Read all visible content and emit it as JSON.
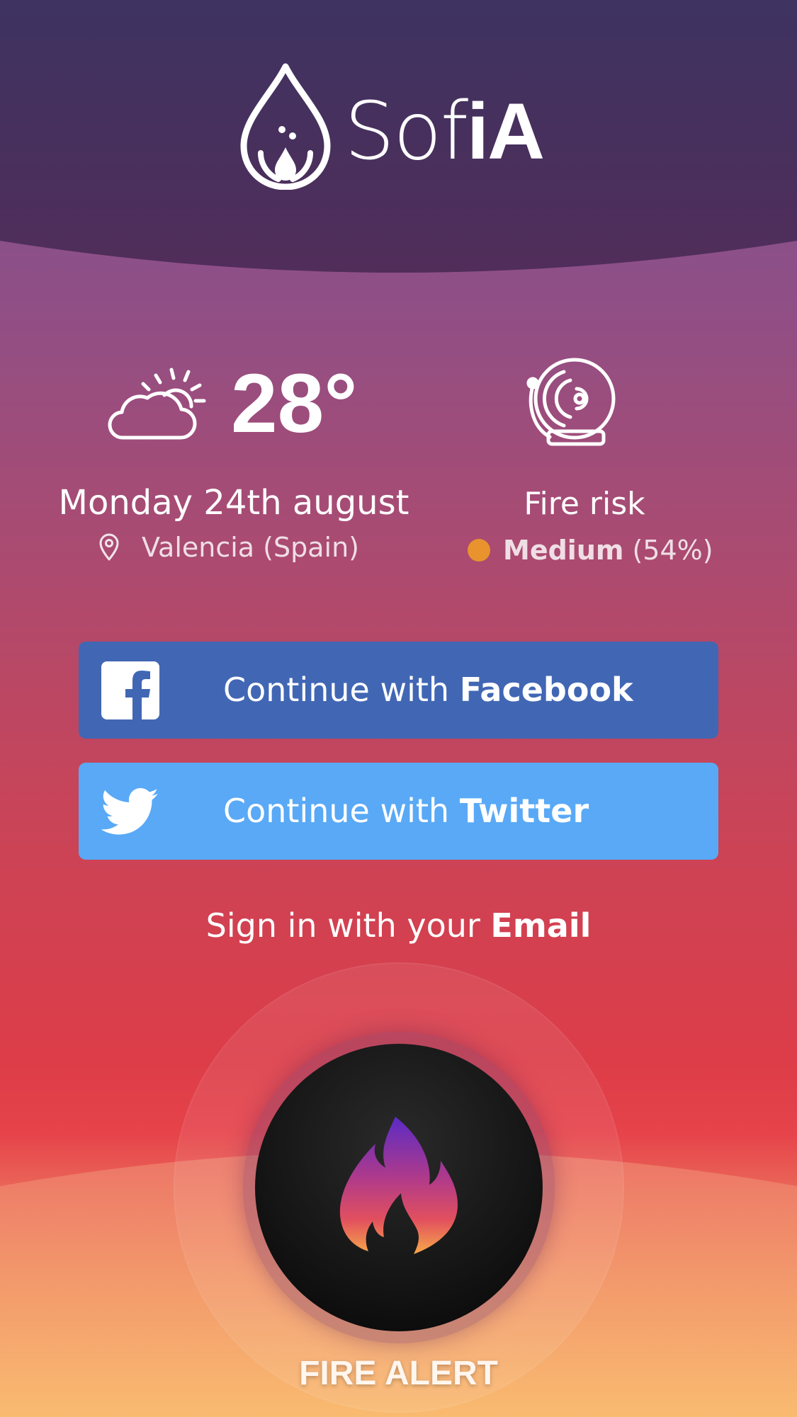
{
  "app": {
    "name_thin": "Sof",
    "name_bold": "iA"
  },
  "weather": {
    "icon": "partly-cloudy-icon",
    "temperature": "28°",
    "date": "Monday 24th august",
    "location_icon": "map-pin-icon",
    "location": "Valencia (Spain)"
  },
  "fire_risk": {
    "icon": "alarm-bell-icon",
    "label": "Fire risk",
    "level": "Medium",
    "percent": "(54%)",
    "dot_color": "#e8932e"
  },
  "buttons": {
    "facebook": {
      "prefix": "Continue with ",
      "brand": "Facebook",
      "icon": "facebook-icon",
      "color": "#4167b4"
    },
    "twitter": {
      "prefix": "Continue with ",
      "brand": "Twitter",
      "icon": "twitter-icon",
      "color": "#59a9f6"
    },
    "email": {
      "prefix": "Sign in with your ",
      "brand": "Email"
    }
  },
  "fire_alert": {
    "label": "FIRE ALERT",
    "icon": "flame-icon"
  }
}
